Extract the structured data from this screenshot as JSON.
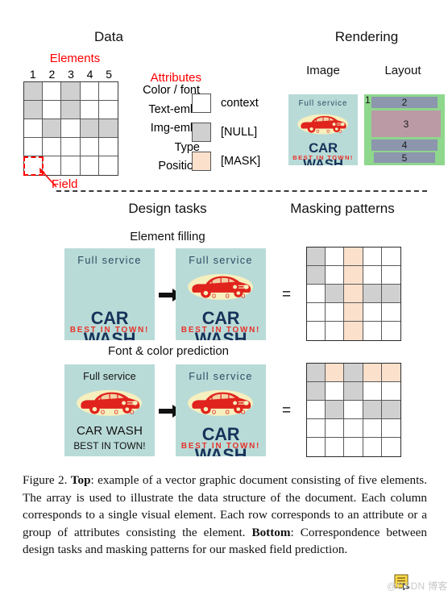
{
  "figure": {
    "top_section_title": "Data",
    "rendering_title": "Rendering",
    "image_title": "Image",
    "layout_title": "Layout",
    "elements_label": "Elements",
    "attributes_label": "Attributes",
    "field_label": "Field",
    "design_tasks_title": "Design tasks",
    "masking_patterns_title": "Masking patterns",
    "task1_title": "Element filling",
    "task2_title": "Font & color prediction",
    "equals_sign": "="
  },
  "colors": {
    "context": "#ffffff",
    "null": "#d0d0d0",
    "mask": "#fbe0cb",
    "red_accent": "#ff0000",
    "poster_bg": "#b9dbd7",
    "poster_navy": "#17325a",
    "poster_red": "#e8312a",
    "layout_bg_green": "#8ed78c",
    "layout_bar": "#8c96ad",
    "layout_image": "#bb9aa6"
  },
  "data_grid": {
    "column_numbers": [
      "1",
      "2",
      "3",
      "4",
      "5"
    ],
    "row_labels": [
      "Color / font",
      "Text-emb.",
      "Img-emb.",
      "Type",
      "Position"
    ],
    "cells": [
      [
        "null",
        "context",
        "null",
        "context",
        "context"
      ],
      [
        "null",
        "context",
        "null",
        "context",
        "context"
      ],
      [
        "context",
        "null",
        "context",
        "null",
        "null"
      ],
      [
        "context",
        "context",
        "context",
        "context",
        "context"
      ],
      [
        "context",
        "context",
        "context",
        "context",
        "context"
      ]
    ]
  },
  "legend": [
    {
      "swatch": "context",
      "label": "context"
    },
    {
      "swatch": "null",
      "label": "[NULL]"
    },
    {
      "swatch": "mask",
      "label": "[MASK]"
    }
  ],
  "poster": {
    "top_text": "Full service",
    "main_text": "CAR WASH",
    "sub_text": "BEST IN TOWN!"
  },
  "layout_elements": [
    {
      "id": "1",
      "kind": "background"
    },
    {
      "id": "2",
      "kind": "bar"
    },
    {
      "id": "3",
      "kind": "image"
    },
    {
      "id": "4",
      "kind": "bar"
    },
    {
      "id": "5",
      "kind": "bar"
    }
  ],
  "tasks": [
    {
      "name": "Element filling",
      "input_poster": {
        "top_text": "Full service",
        "main_text": "CAR WASH",
        "sub_text": "BEST IN TOWN!",
        "has_car": false,
        "styled": true
      },
      "output_poster": {
        "top_text": "Full service",
        "main_text": "CAR WASH",
        "sub_text": "BEST IN TOWN!",
        "has_car": true,
        "styled": true
      },
      "mask_grid": [
        [
          "null",
          "context",
          "mask",
          "context",
          "context"
        ],
        [
          "null",
          "context",
          "mask",
          "context",
          "context"
        ],
        [
          "context",
          "null",
          "mask",
          "null",
          "null"
        ],
        [
          "context",
          "context",
          "mask",
          "context",
          "context"
        ],
        [
          "context",
          "context",
          "mask",
          "context",
          "context"
        ]
      ]
    },
    {
      "name": "Font & color prediction",
      "input_poster": {
        "top_text": "Full service",
        "main_text": "CAR WASH",
        "sub_text": "BEST IN TOWN!",
        "has_car": true,
        "styled": false
      },
      "output_poster": {
        "top_text": "Full service",
        "main_text": "CAR WASH",
        "sub_text": "BEST IN TOWN!",
        "has_car": true,
        "styled": true
      },
      "mask_grid": [
        [
          "null",
          "mask",
          "null",
          "mask",
          "mask"
        ],
        [
          "null",
          "context",
          "null",
          "context",
          "context"
        ],
        [
          "context",
          "null",
          "context",
          "null",
          "null"
        ],
        [
          "context",
          "context",
          "context",
          "context",
          "context"
        ],
        [
          "context",
          "context",
          "context",
          "context",
          "context"
        ]
      ]
    }
  ],
  "caption": {
    "prefix": "Figure 2. ",
    "bold_top": "Top",
    "text_1": ": example of a vector graphic document consisting of five elements. The array is used to illustrate the data structure of the document. Each column corresponds to a single visual element. Each row corresponds to an attribute or a group of attributes consisting the element. ",
    "bold_bottom": "Bottom",
    "text_2": ": Correspondence between design tasks and masking patterns for our masked field prediction."
  },
  "watermark": {
    "text": "@CSDN 博客"
  }
}
